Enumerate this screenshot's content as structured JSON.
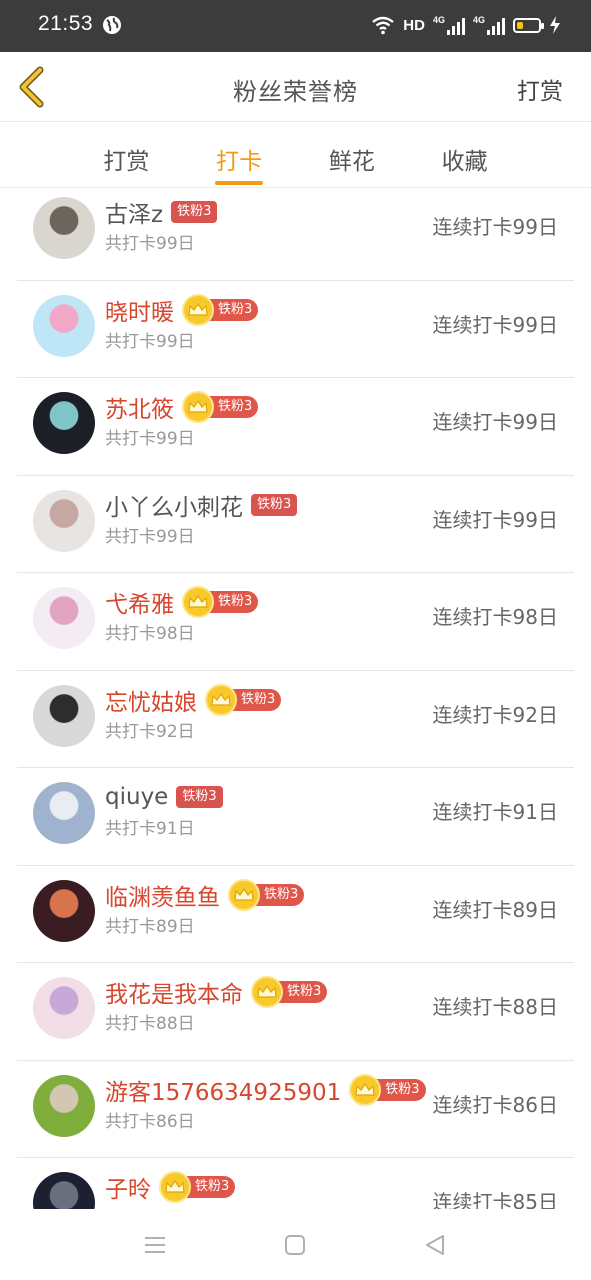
{
  "status_bar": {
    "time": "21:53",
    "network": "HD",
    "signal_1": "4G",
    "signal_2": "4G",
    "battery_level": 0.3
  },
  "header": {
    "title": "粉丝荣誉榜",
    "action": "打赏"
  },
  "tabs": [
    {
      "label": "打赏",
      "active": false
    },
    {
      "label": "打卡",
      "active": true
    },
    {
      "label": "鲜花",
      "active": false
    },
    {
      "label": "收藏",
      "active": false
    }
  ],
  "colors": {
    "accent": "#f09b12",
    "vip_name": "#d9462e",
    "fan_badge": "#d9534f",
    "crown": "#f9c82a"
  },
  "list": [
    {
      "name": "古泽z",
      "vip": false,
      "badge": "铁粉3",
      "total": "共打卡99日",
      "streak": "连续打卡99日",
      "avatar_icon": "panda-avatar",
      "avatar_colors": [
        "#d9d6d0",
        "#6d655b"
      ]
    },
    {
      "name": "晓时暖",
      "vip": true,
      "badge": "铁粉3",
      "total": "共打卡99日",
      "streak": "连续打卡99日",
      "avatar_icon": "girl-avatar",
      "avatar_colors": [
        "#bfe6f6",
        "#f1a8c6"
      ]
    },
    {
      "name": "苏北筱",
      "vip": true,
      "badge": "铁粉3",
      "total": "共打卡99日",
      "streak": "连续打卡99日",
      "avatar_icon": "girl-avatar",
      "avatar_colors": [
        "#1d1f27",
        "#7fc6c8"
      ]
    },
    {
      "name": "小丫么小刺花",
      "vip": false,
      "badge": "铁粉3",
      "total": "共打卡99日",
      "streak": "连续打卡99日",
      "avatar_icon": "hands-avatar",
      "avatar_colors": [
        "#e8e4e2",
        "#c7a7a2"
      ]
    },
    {
      "name": "弋希雅",
      "vip": true,
      "badge": "铁粉3",
      "total": "共打卡98日",
      "streak": "连续打卡98日",
      "avatar_icon": "bunny-avatar",
      "avatar_colors": [
        "#f4ecf3",
        "#e2a4c3"
      ]
    },
    {
      "name": "忘忧姑娘",
      "vip": true,
      "badge": "铁粉3",
      "total": "共打卡92日",
      "streak": "连续打卡92日",
      "avatar_icon": "boy-avatar",
      "avatar_colors": [
        "#d8d8d8",
        "#2d2d2f"
      ]
    },
    {
      "name": "qiuye",
      "vip": false,
      "badge": "铁粉3",
      "total": "共打卡91日",
      "streak": "连续打卡91日",
      "avatar_icon": "mountain-avatar",
      "avatar_colors": [
        "#9fb3cf",
        "#e8edf4"
      ]
    },
    {
      "name": "临渊羡鱼鱼",
      "vip": true,
      "badge": "铁粉3",
      "total": "共打卡89日",
      "streak": "连续打卡89日",
      "avatar_icon": "bokeh-avatar",
      "avatar_colors": [
        "#3a1d22",
        "#d9734c"
      ]
    },
    {
      "name": "我花是我本命",
      "vip": true,
      "badge": "铁粉3",
      "total": "共打卡88日",
      "streak": "连续打卡88日",
      "avatar_icon": "anime-girl-avatar",
      "avatar_colors": [
        "#f3dde6",
        "#c9a7d9"
      ]
    },
    {
      "name": "游客1576634925901",
      "vip": true,
      "badge": "铁粉3",
      "total": "共打卡86日",
      "streak": "连续打卡86日",
      "avatar_icon": "cat-avatar",
      "avatar_colors": [
        "#7fae3c",
        "#d3c6b3"
      ]
    },
    {
      "name": "子昤",
      "vip": true,
      "badge": "铁粉3",
      "total": "",
      "streak": "连续打卡85日",
      "avatar_icon": "dark-boy-avatar",
      "avatar_colors": [
        "#1c2030",
        "#6b6f7d"
      ]
    }
  ]
}
